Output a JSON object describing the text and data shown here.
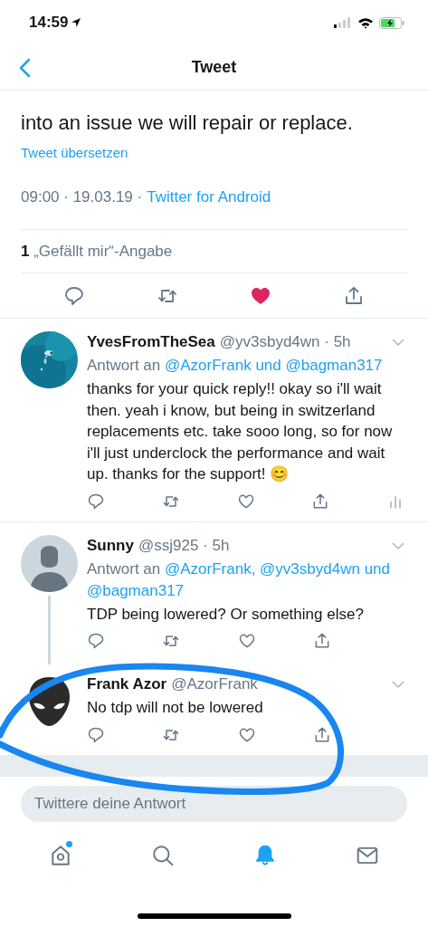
{
  "status_bar": {
    "time": "14:59"
  },
  "nav": {
    "title": "Tweet"
  },
  "tweet": {
    "text_lines": [
      "into an issue we will repair or replace."
    ],
    "translate": "Tweet übersetzen",
    "meta": "09:00 · 19.03.19 ·",
    "source": "Twitter for Android",
    "likes": "**1** „Gefällt mir“-Angabe",
    "liked": true
  },
  "replies": [
    {
      "name": "YvesFromTheSea",
      "handle": "@yv3sbyd4wn · 5h",
      "reply_label": "Antwort an",
      "reply_users": "@AzorFrank und @bagman317",
      "text": "thanks for your quick reply!! okay so i'll wait then. yeah i know, but being in switzerland replacements etc. take sooo long, so for now i'll just underclock the performance and wait up. thanks for the support! 😊",
      "liked": false,
      "stats": true,
      "thread_line": false
    },
    {
      "avatar": {
        "kind": "default"
      },
      "name": "Sunny",
      "handle": "@ssj925 · 5h",
      "reply_label": "Antwort an",
      "reply_users": "@AzorFrank, @yv3sbyd4wn und @bagman317",
      "text": "TDP being lowered? Or something else?",
      "liked": false,
      "stats": false,
      "thread_line": true
    },
    {
      "avatar": {
        "kind": "alien"
      },
      "name": "Frank Azor",
      "handle": "@AzorFrank",
      "text": "No tdp will not be lowered",
      "liked": false,
      "stats": false,
      "thread_line": false
    }
  ],
  "reply_field": {
    "placeholder": "Twittere deine Antwort"
  },
  "tabs": [
    {
      "kind": "home",
      "selected": false,
      "badge": true
    },
    {
      "kind": "search",
      "selected": false,
      "badge": false
    },
    {
      "kind": "notifications",
      "selected": true,
      "badge": false
    },
    {
      "kind": "messages",
      "selected": false,
      "badge": false
    }
  ]
}
